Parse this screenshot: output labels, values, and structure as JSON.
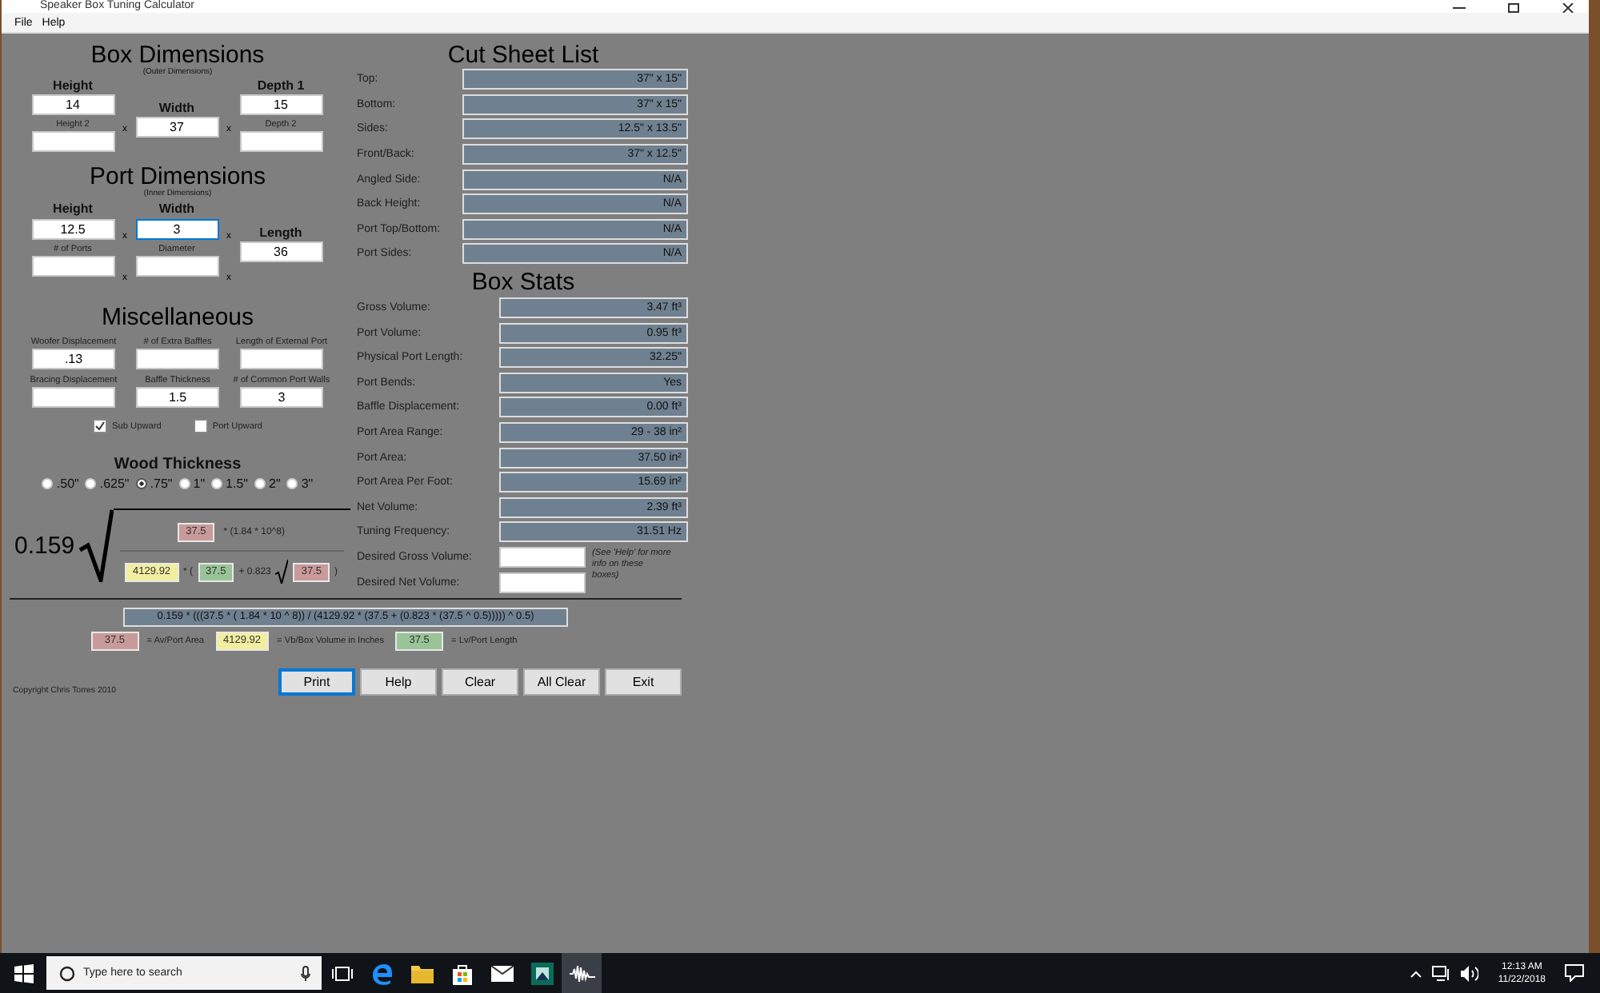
{
  "window": {
    "title": "Speaker Box Tuning Calculator"
  },
  "menu": [
    "File",
    "Help"
  ],
  "box_dimensions": {
    "title": "Box Dimensions",
    "subtitle": "(Outer Dimensions)",
    "columns": [
      [
        {
          "label": "Height",
          "kind": "main",
          "value": "14",
          "focused": false
        },
        {
          "label": "Height 2",
          "kind": "sub",
          "focused": false
        }
      ],
      [
        {
          "label": "Width",
          "kind": "main",
          "value": "37",
          "focused": false
        }
      ],
      [
        {
          "label": "Depth 1",
          "kind": "main",
          "value": "15",
          "focused": false
        },
        {
          "label": "Depth 2",
          "kind": "sub",
          "focused": false
        }
      ]
    ],
    "separators": [
      [
        "x"
      ],
      [
        "x"
      ]
    ]
  },
  "port_dimensions": {
    "title": "Port Dimensions",
    "subtitle": "(Inner Dimensions)",
    "columns": [
      [
        {
          "label": "Height",
          "kind": "main",
          "value": "12.5",
          "focused": false
        },
        {
          "label": "# of Ports",
          "kind": "sub",
          "focused": false
        }
      ],
      [
        {
          "label": "Width",
          "kind": "main",
          "value": "3",
          "focused": true
        },
        {
          "label": "Diameter",
          "kind": "sub",
          "focused": false
        }
      ],
      [
        {
          "label": "Length",
          "kind": "main",
          "value": "36",
          "focused": false
        }
      ]
    ],
    "separators": [
      [
        "x",
        "x"
      ],
      [
        "x",
        "x"
      ]
    ]
  },
  "miscellaneous": {
    "title": "Miscellaneous",
    "fields": [
      {
        "label": "Woofer Displacement",
        "value": ".13"
      },
      {
        "label": "# of Extra Baffles"
      },
      {
        "label": "Length of External Port"
      },
      {
        "label": "Bracing Displacement"
      },
      {
        "label": "Baffle Thickness",
        "value": "1.5"
      },
      {
        "label": "# of Common Port Walls",
        "value": "3"
      }
    ],
    "checkboxes": [
      {
        "label": "Sub Upward",
        "checked": true
      },
      {
        "label": "Port Upward",
        "checked": false
      }
    ]
  },
  "wood_thickness": {
    "title": "Wood Thickness",
    "options": [
      {
        "label": ".50\"",
        "selected": false
      },
      {
        "label": ".625\"",
        "selected": false
      },
      {
        "label": ".75\"",
        "selected": true
      },
      {
        "label": "1\"",
        "selected": false
      },
      {
        "label": "1.5\"",
        "selected": false
      },
      {
        "label": "2\"",
        "selected": false
      },
      {
        "label": "3\"",
        "selected": false
      }
    ]
  },
  "formula": {
    "coefficient": "0.159",
    "numerator": [
      {
        "kind": "value",
        "text": "37.5",
        "color": "#c99a9a"
      },
      {
        "kind": "text",
        "text": "* (1.84 * 10^8)"
      }
    ],
    "denominator": [
      {
        "kind": "value",
        "text": "4129.92",
        "color": "#f2eea0"
      },
      {
        "kind": "text",
        "text": "* ("
      },
      {
        "kind": "value",
        "text": "37.5",
        "color": "#98c498"
      },
      {
        "kind": "text",
        "text": "+ 0.823"
      },
      {
        "kind": "root"
      },
      {
        "kind": "value",
        "text": "37.5",
        "color": "#c99a9a"
      },
      {
        "kind": "text",
        "text": ")"
      }
    ]
  },
  "expression": "0.159 * (((37.5 * ( 1.84 * 10 ^ 8)) / (4129.92 * (37.5 + (0.823 * (37.5 ^ 0.5))))) ^ 0.5)",
  "legend": [
    {
      "value": "37.5",
      "color": "#c99a9a",
      "text": "= Av/Port Area"
    },
    {
      "value": "4129.92",
      "color": "#f2eea0",
      "text": "= Vb/Box Volume in Inches"
    },
    {
      "value": "37.5",
      "color": "#98c498",
      "text": "= Lv/Port Length"
    }
  ],
  "copyright": "Copyright Chris Torres 2010",
  "buttons": [
    {
      "label": "Print",
      "focused": true
    },
    {
      "label": "Help",
      "focused": false
    },
    {
      "label": "Clear",
      "focused": false
    },
    {
      "label": "All Clear",
      "focused": false
    },
    {
      "label": "Exit",
      "focused": false
    }
  ],
  "cut_sheet": {
    "title": "Cut Sheet List",
    "rows": [
      {
        "label": "Top:",
        "value": "37\" x 15\""
      },
      {
        "label": "Bottom:",
        "value": "37\" x 15\""
      },
      {
        "label": "Sides:",
        "value": "12.5\" x 13.5\""
      },
      {
        "label": "Front/Back:",
        "value": "37\" x 12.5\""
      },
      {
        "label": "Angled Side:",
        "value": "N/A"
      },
      {
        "label": "Back Height:",
        "value": "N/A"
      },
      {
        "label": "Port Top/Bottom:",
        "value": "N/A"
      },
      {
        "label": "Port Sides:",
        "value": "N/A"
      }
    ]
  },
  "box_stats": {
    "title": "Box Stats",
    "rows": [
      {
        "label": "Gross Volume:",
        "value": "3.47 ft³"
      },
      {
        "label": "Port Volume:",
        "value": "0.95 ft³"
      },
      {
        "label": "Physical Port Length:",
        "value": "32.25\""
      },
      {
        "label": "Port Bends:",
        "value": "Yes"
      },
      {
        "label": "Baffle Displacement:",
        "value": "0.00 ft³"
      },
      {
        "label": "Port Area Range:",
        "value": "29 - 38 in²"
      },
      {
        "label": "Port Area:",
        "value": "37.50 in²"
      },
      {
        "label": "Port Area Per Foot:",
        "value": "15.69 in²"
      },
      {
        "label": "Net Volume:",
        "value": "2.39 ft³"
      },
      {
        "label": "Tuning Frequency:",
        "value": "31.51 Hz"
      }
    ],
    "desired": [
      {
        "label": "Desired Gross Volume:"
      },
      {
        "label": "Desired Net Volume:"
      }
    ],
    "note": "(See 'Help' for more info on these boxes)"
  },
  "taskbar": {
    "search_placeholder": "Type here to search",
    "apps": [
      {
        "kind": "taskview",
        "active": false
      },
      {
        "kind": "edge",
        "active": false
      },
      {
        "kind": "folder",
        "active": false
      },
      {
        "kind": "store",
        "active": false
      },
      {
        "kind": "mail",
        "active": false
      },
      {
        "kind": "app",
        "active": false
      },
      {
        "kind": "wave",
        "active": true
      }
    ],
    "time": "12:13 AM",
    "date": "11/22/2018"
  }
}
